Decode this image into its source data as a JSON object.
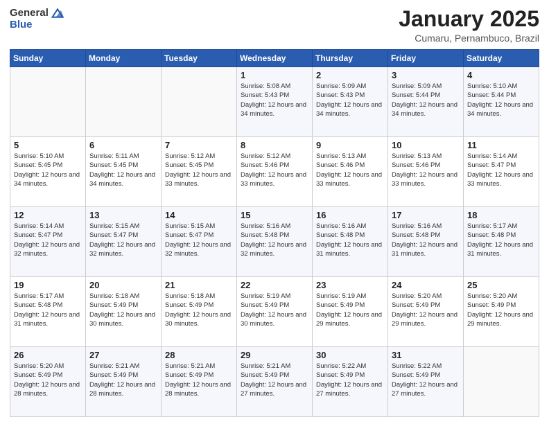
{
  "logo": {
    "general": "General",
    "blue": "Blue"
  },
  "header": {
    "month": "January 2025",
    "location": "Cumaru, Pernambuco, Brazil"
  },
  "weekdays": [
    "Sunday",
    "Monday",
    "Tuesday",
    "Wednesday",
    "Thursday",
    "Friday",
    "Saturday"
  ],
  "weeks": [
    [
      {
        "day": "",
        "sunrise": "",
        "sunset": "",
        "daylight": ""
      },
      {
        "day": "",
        "sunrise": "",
        "sunset": "",
        "daylight": ""
      },
      {
        "day": "",
        "sunrise": "",
        "sunset": "",
        "daylight": ""
      },
      {
        "day": "1",
        "sunrise": "Sunrise: 5:08 AM",
        "sunset": "Sunset: 5:43 PM",
        "daylight": "Daylight: 12 hours and 34 minutes."
      },
      {
        "day": "2",
        "sunrise": "Sunrise: 5:09 AM",
        "sunset": "Sunset: 5:43 PM",
        "daylight": "Daylight: 12 hours and 34 minutes."
      },
      {
        "day": "3",
        "sunrise": "Sunrise: 5:09 AM",
        "sunset": "Sunset: 5:44 PM",
        "daylight": "Daylight: 12 hours and 34 minutes."
      },
      {
        "day": "4",
        "sunrise": "Sunrise: 5:10 AM",
        "sunset": "Sunset: 5:44 PM",
        "daylight": "Daylight: 12 hours and 34 minutes."
      }
    ],
    [
      {
        "day": "5",
        "sunrise": "Sunrise: 5:10 AM",
        "sunset": "Sunset: 5:45 PM",
        "daylight": "Daylight: 12 hours and 34 minutes."
      },
      {
        "day": "6",
        "sunrise": "Sunrise: 5:11 AM",
        "sunset": "Sunset: 5:45 PM",
        "daylight": "Daylight: 12 hours and 34 minutes."
      },
      {
        "day": "7",
        "sunrise": "Sunrise: 5:12 AM",
        "sunset": "Sunset: 5:45 PM",
        "daylight": "Daylight: 12 hours and 33 minutes."
      },
      {
        "day": "8",
        "sunrise": "Sunrise: 5:12 AM",
        "sunset": "Sunset: 5:46 PM",
        "daylight": "Daylight: 12 hours and 33 minutes."
      },
      {
        "day": "9",
        "sunrise": "Sunrise: 5:13 AM",
        "sunset": "Sunset: 5:46 PM",
        "daylight": "Daylight: 12 hours and 33 minutes."
      },
      {
        "day": "10",
        "sunrise": "Sunrise: 5:13 AM",
        "sunset": "Sunset: 5:46 PM",
        "daylight": "Daylight: 12 hours and 33 minutes."
      },
      {
        "day": "11",
        "sunrise": "Sunrise: 5:14 AM",
        "sunset": "Sunset: 5:47 PM",
        "daylight": "Daylight: 12 hours and 33 minutes."
      }
    ],
    [
      {
        "day": "12",
        "sunrise": "Sunrise: 5:14 AM",
        "sunset": "Sunset: 5:47 PM",
        "daylight": "Daylight: 12 hours and 32 minutes."
      },
      {
        "day": "13",
        "sunrise": "Sunrise: 5:15 AM",
        "sunset": "Sunset: 5:47 PM",
        "daylight": "Daylight: 12 hours and 32 minutes."
      },
      {
        "day": "14",
        "sunrise": "Sunrise: 5:15 AM",
        "sunset": "Sunset: 5:47 PM",
        "daylight": "Daylight: 12 hours and 32 minutes."
      },
      {
        "day": "15",
        "sunrise": "Sunrise: 5:16 AM",
        "sunset": "Sunset: 5:48 PM",
        "daylight": "Daylight: 12 hours and 32 minutes."
      },
      {
        "day": "16",
        "sunrise": "Sunrise: 5:16 AM",
        "sunset": "Sunset: 5:48 PM",
        "daylight": "Daylight: 12 hours and 31 minutes."
      },
      {
        "day": "17",
        "sunrise": "Sunrise: 5:16 AM",
        "sunset": "Sunset: 5:48 PM",
        "daylight": "Daylight: 12 hours and 31 minutes."
      },
      {
        "day": "18",
        "sunrise": "Sunrise: 5:17 AM",
        "sunset": "Sunset: 5:48 PM",
        "daylight": "Daylight: 12 hours and 31 minutes."
      }
    ],
    [
      {
        "day": "19",
        "sunrise": "Sunrise: 5:17 AM",
        "sunset": "Sunset: 5:48 PM",
        "daylight": "Daylight: 12 hours and 31 minutes."
      },
      {
        "day": "20",
        "sunrise": "Sunrise: 5:18 AM",
        "sunset": "Sunset: 5:49 PM",
        "daylight": "Daylight: 12 hours and 30 minutes."
      },
      {
        "day": "21",
        "sunrise": "Sunrise: 5:18 AM",
        "sunset": "Sunset: 5:49 PM",
        "daylight": "Daylight: 12 hours and 30 minutes."
      },
      {
        "day": "22",
        "sunrise": "Sunrise: 5:19 AM",
        "sunset": "Sunset: 5:49 PM",
        "daylight": "Daylight: 12 hours and 30 minutes."
      },
      {
        "day": "23",
        "sunrise": "Sunrise: 5:19 AM",
        "sunset": "Sunset: 5:49 PM",
        "daylight": "Daylight: 12 hours and 29 minutes."
      },
      {
        "day": "24",
        "sunrise": "Sunrise: 5:20 AM",
        "sunset": "Sunset: 5:49 PM",
        "daylight": "Daylight: 12 hours and 29 minutes."
      },
      {
        "day": "25",
        "sunrise": "Sunrise: 5:20 AM",
        "sunset": "Sunset: 5:49 PM",
        "daylight": "Daylight: 12 hours and 29 minutes."
      }
    ],
    [
      {
        "day": "26",
        "sunrise": "Sunrise: 5:20 AM",
        "sunset": "Sunset: 5:49 PM",
        "daylight": "Daylight: 12 hours and 28 minutes."
      },
      {
        "day": "27",
        "sunrise": "Sunrise: 5:21 AM",
        "sunset": "Sunset: 5:49 PM",
        "daylight": "Daylight: 12 hours and 28 minutes."
      },
      {
        "day": "28",
        "sunrise": "Sunrise: 5:21 AM",
        "sunset": "Sunset: 5:49 PM",
        "daylight": "Daylight: 12 hours and 28 minutes."
      },
      {
        "day": "29",
        "sunrise": "Sunrise: 5:21 AM",
        "sunset": "Sunset: 5:49 PM",
        "daylight": "Daylight: 12 hours and 27 minutes."
      },
      {
        "day": "30",
        "sunrise": "Sunrise: 5:22 AM",
        "sunset": "Sunset: 5:49 PM",
        "daylight": "Daylight: 12 hours and 27 minutes."
      },
      {
        "day": "31",
        "sunrise": "Sunrise: 5:22 AM",
        "sunset": "Sunset: 5:49 PM",
        "daylight": "Daylight: 12 hours and 27 minutes."
      },
      {
        "day": "",
        "sunrise": "",
        "sunset": "",
        "daylight": ""
      }
    ]
  ]
}
